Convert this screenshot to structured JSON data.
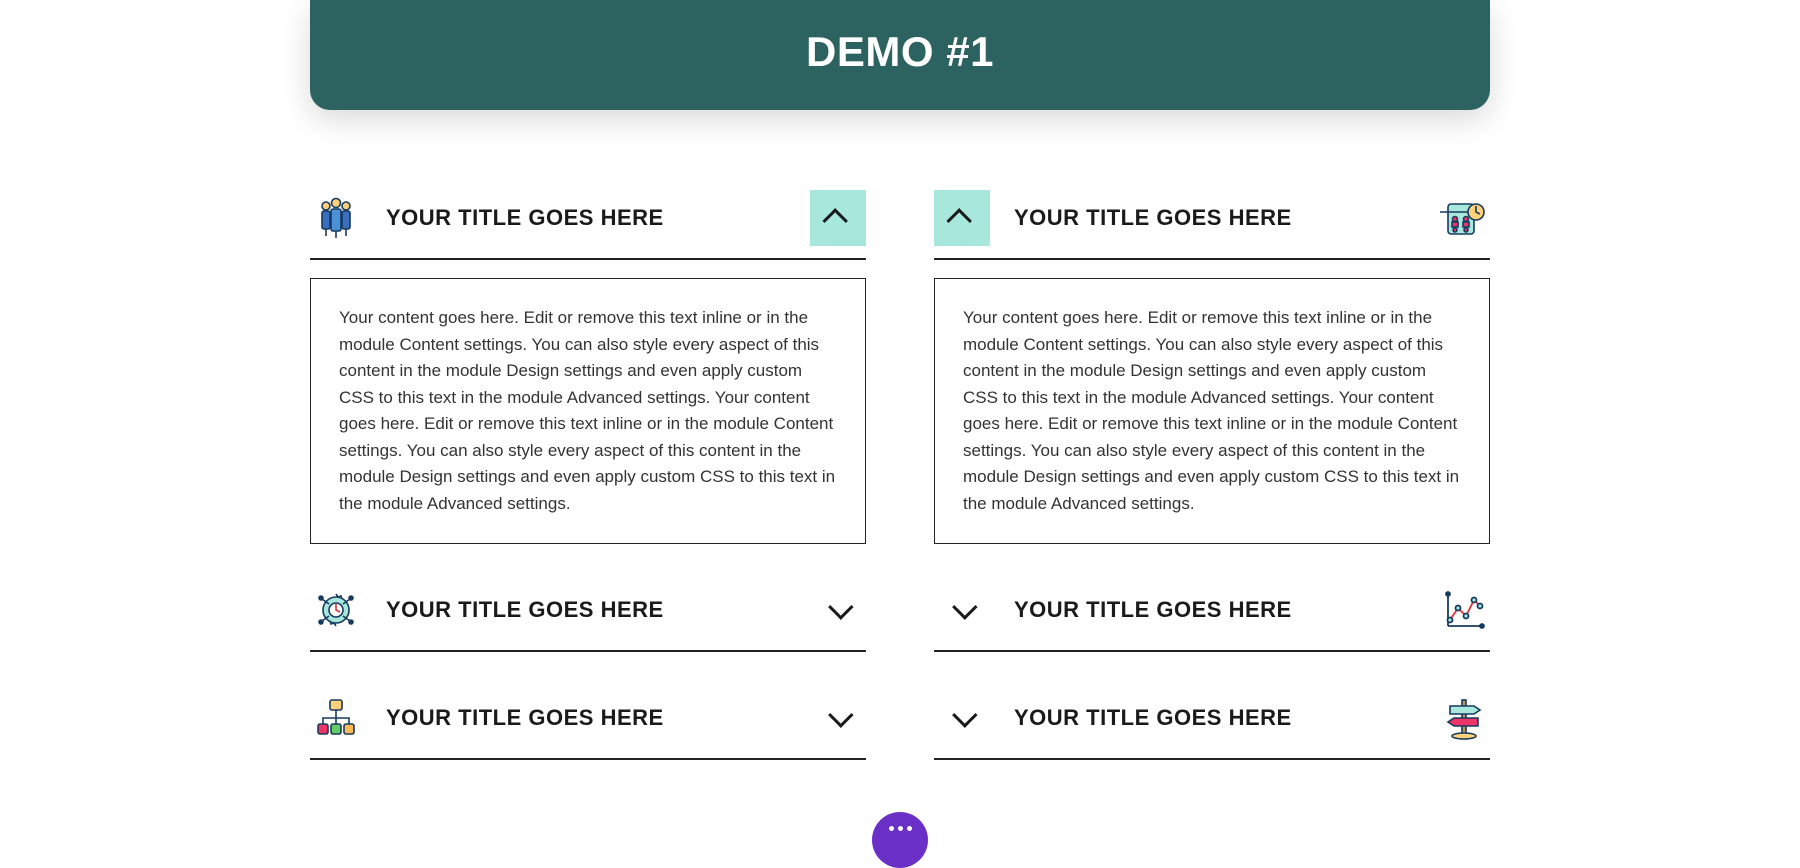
{
  "header": {
    "title": "DEMO #1"
  },
  "leftColumn": {
    "items": [
      {
        "title": "YOUR TITLE GOES HERE",
        "open": true,
        "body": "Your content goes here. Edit or remove this text inline or in the module Content settings. You can also style every aspect of this content in the module Design settings and even apply custom CSS to this text in the module Advanced settings. Your content goes here. Edit or remove this text inline or in the module Content settings. You can also style every aspect of this content in the module Design settings and even apply custom CSS to this text in the module Advanced settings."
      },
      {
        "title": "YOUR TITLE GOES HERE",
        "open": false
      },
      {
        "title": "YOUR TITLE GOES HERE",
        "open": false
      }
    ]
  },
  "rightColumn": {
    "items": [
      {
        "title": "YOUR TITLE GOES HERE",
        "open": true,
        "body": "Your content goes here. Edit or remove this text inline or in the module Content settings. You can also style every aspect of this content in the module Design settings and even apply custom CSS to this text in the module Advanced settings. Your content goes here. Edit or remove this text inline or in the module Content settings. You can also style every aspect of this content in the module Design settings and even apply custom CSS to this text in the module Advanced settings."
      },
      {
        "title": "YOUR TITLE GOES HERE",
        "open": false
      },
      {
        "title": "YOUR TITLE GOES HERE",
        "open": false
      }
    ]
  },
  "icons": {
    "left": [
      "people-icon",
      "gear-clock-icon",
      "org-chart-icon"
    ],
    "right": [
      "calendar-people-icon",
      "analytics-icon",
      "signpost-icon"
    ]
  },
  "colors": {
    "headerBg": "#2c6260",
    "chevronOpenBg": "#a8e8dc",
    "fabBg": "#6a2fc6"
  }
}
